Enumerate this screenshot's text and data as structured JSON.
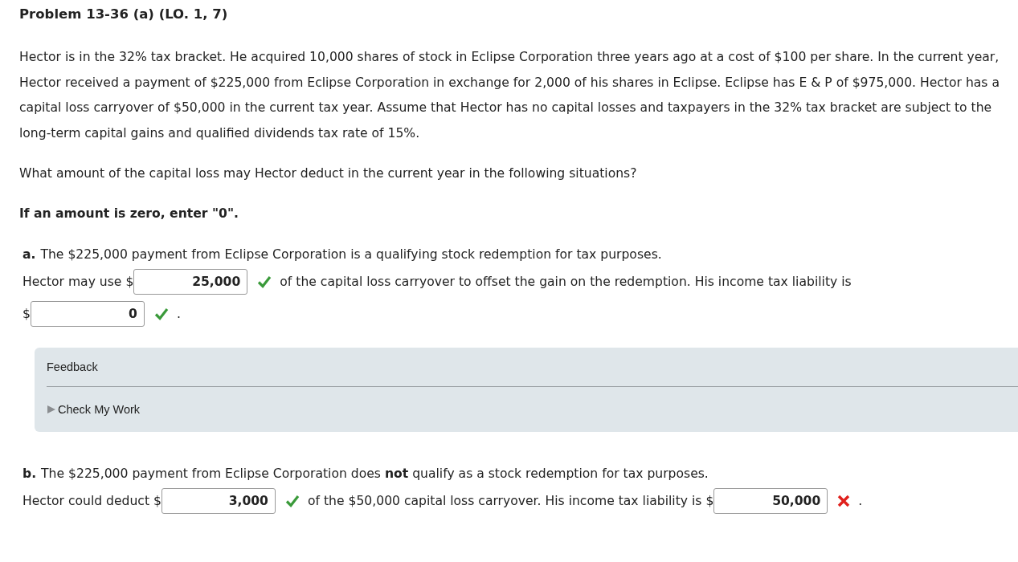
{
  "title": "Problem 13-36 (a) (LO. 1, 7)",
  "paragraphs": [
    "Hector is in the 32% tax bracket. He acquired 10,000 shares of stock in Eclipse Corporation three years ago at a cost of $100 per share. In the current year, Hector received a payment of $225,000 from Eclipse Corporation in exchange for 2,000 of his shares in Eclipse. Eclipse has E & P of $975,000. Hector has a capital loss carryover of $50,000 in the current tax year. Assume that Hector has no capital losses and taxpayers in the 32% tax bracket are subject to the long-term capital gains and qualified dividends tax rate of 15%.",
    "What amount of the capital loss may Hector deduct in the current year in the following situations?"
  ],
  "instruction": "If an amount is zero, enter \"0\".",
  "parts": [
    {
      "label": "a.",
      "prompt": "The $225,000 payment from Eclipse Corporation is a qualifying stock redemption for tax purposes.",
      "segments": [
        {
          "kind": "text",
          "text": "Hector may use $"
        },
        {
          "kind": "answer",
          "value": "25,000",
          "correct": true
        },
        {
          "kind": "text",
          "text": "of the capital loss carryover to offset the gain on the redemption. His income tax liability is"
        },
        {
          "kind": "break"
        },
        {
          "kind": "text",
          "text": "$"
        },
        {
          "kind": "answer",
          "value": "0",
          "correct": true
        },
        {
          "kind": "text",
          "text": "."
        }
      ],
      "feedback": {
        "title": "Feedback",
        "toggle": "Check My Work",
        "expanded": false
      }
    },
    {
      "label": "b.",
      "prompt": "The $225,000 payment from Eclipse Corporation does **not** qualify as a stock redemption for tax purposes.",
      "segments": [
        {
          "kind": "text",
          "text": "Hector could deduct $"
        },
        {
          "kind": "answer",
          "value": "3,000",
          "correct": true
        },
        {
          "kind": "text",
          "text": "of the $50,000 capital loss carryover. His income tax liability is $"
        },
        {
          "kind": "answer",
          "value": "50,000",
          "correct": false
        },
        {
          "kind": "text",
          "text": "."
        }
      ]
    }
  ]
}
